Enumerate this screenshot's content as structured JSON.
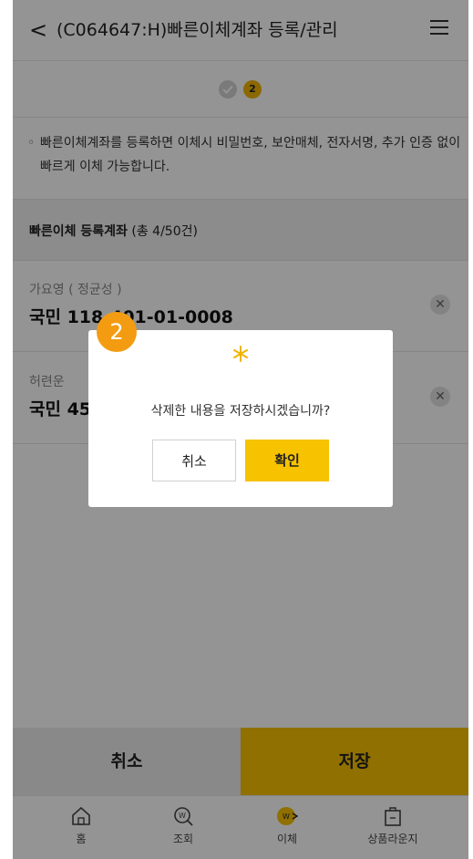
{
  "header": {
    "back_glyph": "<",
    "title": "(C064647:H)빠른이체계좌 등록/관리"
  },
  "steps": {
    "current": "2"
  },
  "notice": {
    "text": "빠른이체계좌를 등록하면 이체시 비밀번호, 보안매체, 전자서명, 추가 인증 없이 빠르게 이체 가능합니다."
  },
  "section": {
    "title": "빠른이체 등록계좌",
    "count": "(총 4/50건)"
  },
  "accounts": [
    {
      "name": "가요영 ( 정균성 )",
      "account": "국민 118-401-01-0008"
    },
    {
      "name": "허련운",
      "account": "국민 45"
    }
  ],
  "bottom": {
    "cancel_label": "취소",
    "save_label": "저장"
  },
  "tabs": [
    {
      "label": "홈",
      "icon": "home-icon"
    },
    {
      "label": "조회",
      "icon": "inquiry-icon"
    },
    {
      "label": "이체",
      "icon": "transfer-icon"
    },
    {
      "label": "상품라운지",
      "icon": "product-lounge-icon"
    }
  ],
  "dialog": {
    "message": "삭제한 내용을 저장하시겠습니까?",
    "cancel_label": "취소",
    "ok_label": "확인"
  },
  "marker": {
    "label": "2"
  },
  "colors": {
    "accent": "#f7c200",
    "marker": "#f39c12"
  }
}
